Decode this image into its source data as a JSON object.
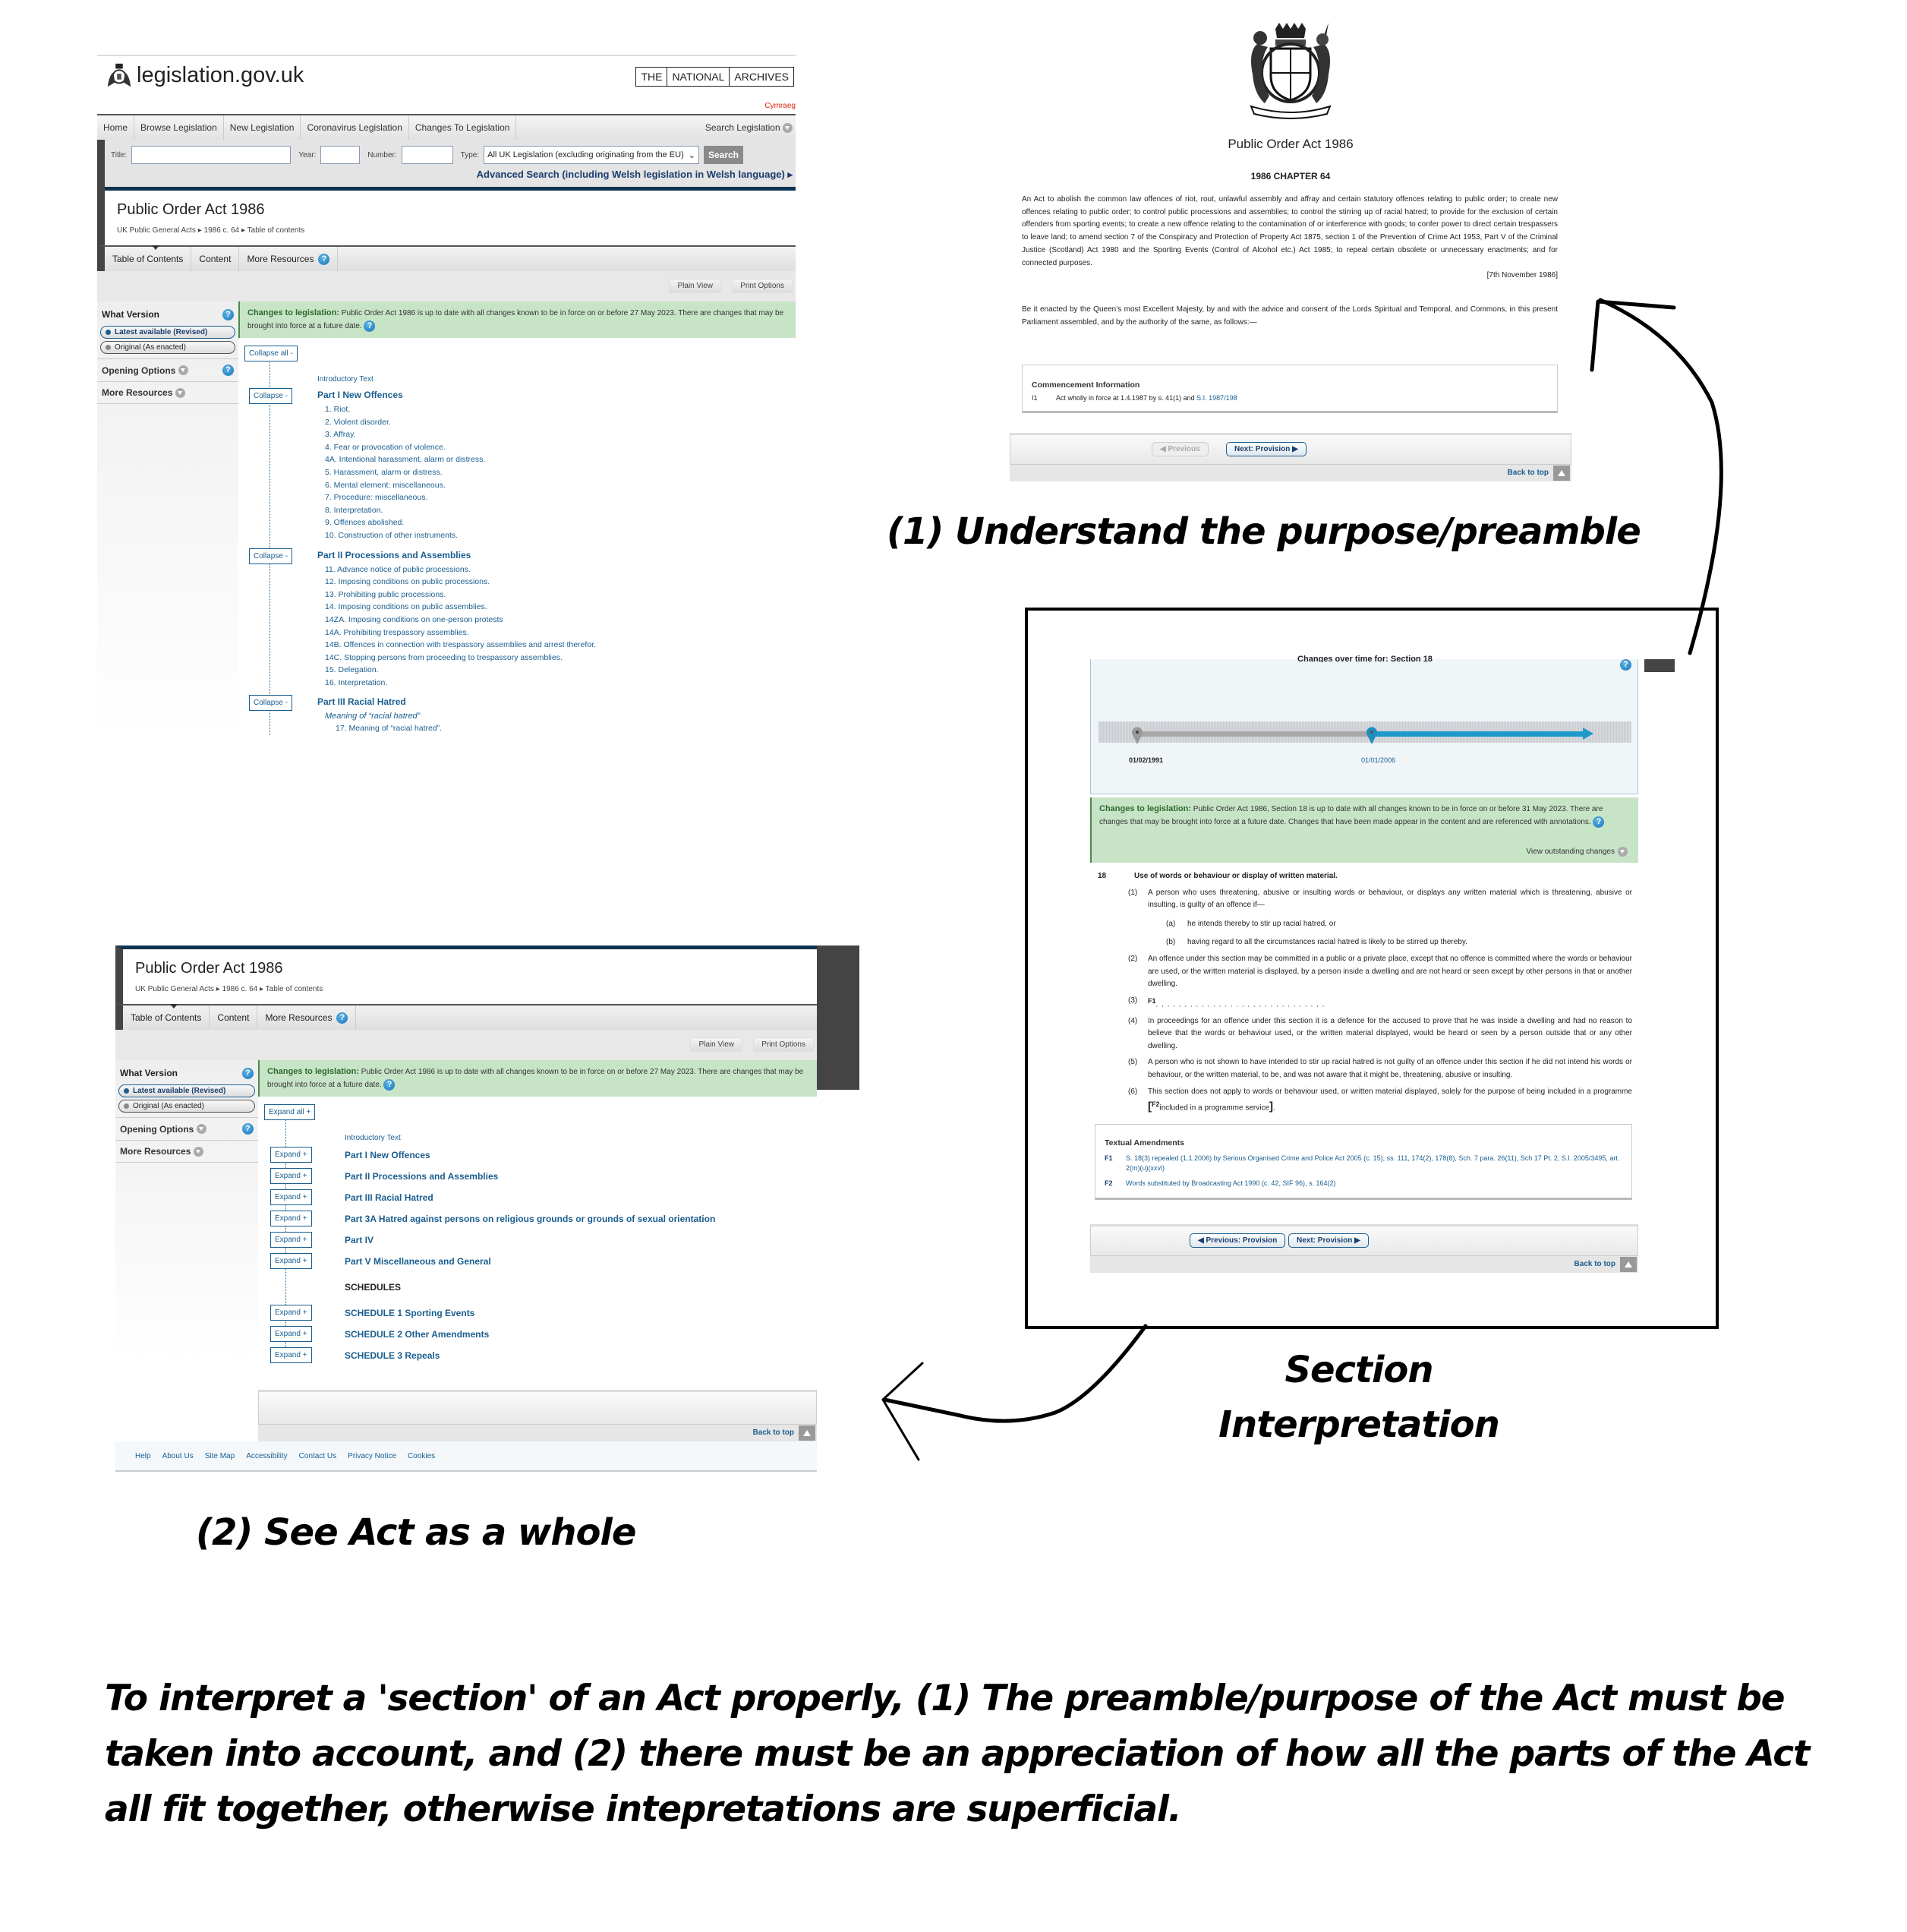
{
  "site": {
    "logo_text": "legislation.gov.uk",
    "tna": [
      "THE",
      "NATIONAL",
      "ARCHIVES"
    ],
    "cymraeg": "Cymraeg",
    "nav": [
      "Home",
      "Browse Legislation",
      "New Legislation",
      "Coronavirus Legislation",
      "Changes To Legislation"
    ],
    "search_legislation": "Search Legislation",
    "search": {
      "title_label": "Title:",
      "title_value": "",
      "year_label": "Year:",
      "year_value": "",
      "number_label": "Number:",
      "number_value": "",
      "type_label": "Type:",
      "type_value": "All UK Legislation (excluding originating from the EU)",
      "search_button": "Search",
      "advanced": "Advanced Search (including Welsh legislation in Welsh language)"
    }
  },
  "act": {
    "title": "Public Order Act 1986",
    "breadcrumb": [
      "UK Public General Acts",
      "1986 c. 64",
      "Table of contents"
    ],
    "tabs": [
      "Table of Contents",
      "Content",
      "More Resources"
    ],
    "plain_view": "Plain View",
    "print_options": "Print Options",
    "what_version": "What Version",
    "latest": "Latest available (Revised)",
    "original": "Original (As enacted)",
    "opening_options": "Opening Options",
    "more_resources": "More Resources",
    "changes_label": "Changes to legislation:",
    "changes_text": "Public Order Act 1986 is up to date with all changes known to be in force on or before 27 May 2023. There are changes that may be brought into force at a future date."
  },
  "toc_expanded": {
    "collapse_all": "Collapse all -",
    "collapse": "Collapse -",
    "introductory": "Introductory Text",
    "parts": [
      {
        "title": "Part I New Offences",
        "sections": [
          "1.  Riot.",
          "2.  Violent disorder.",
          "3.  Affray.",
          "4.  Fear or provocation of violence.",
          "4A.  Intentional harassment, alarm or distress.",
          "5.  Harassment, alarm or distress.",
          "6.  Mental element: miscellaneous.",
          "7.  Procedure: miscellaneous.",
          "8.  Interpretation.",
          "9.  Offences abolished.",
          "10.  Construction of other instruments."
        ]
      },
      {
        "title": "Part II Processions and Assemblies",
        "sections": [
          "11.  Advance notice of public processions.",
          "12.  Imposing conditions on public processions.",
          "13.  Prohibiting public processions.",
          "14.  Imposing conditions on public assemblies.",
          "14ZA. Imposing conditions on one-person protests",
          "14A.  Prohibiting trespassory assemblies.",
          "14B.  Offences in connection with trespassory assemblies and arrest therefor.",
          "14C.  Stopping persons from proceeding to trespassory assemblies.",
          "15. Delegation.",
          "16.  Interpretation."
        ]
      },
      {
        "title": "Part III Racial Hatred",
        "subheading": "Meaning of “racial hatred”",
        "sections": [
          "17.  Meaning of “racial hatred”."
        ]
      }
    ]
  },
  "preamble": {
    "title": "Public Order Act 1986",
    "chapter": "1986 CHAPTER 64",
    "long_title": "An Act to abolish the common law offences of riot, rout, unlawful assembly and affray and certain statutory offences relating to public order; to create new offences relating to public order; to control public processions and assemblies; to control the stirring up of racial hatred; to provide for the exclusion of certain offenders from sporting events; to create a new offence relating to the contamination of or interference with goods; to confer power to direct certain trespassers to leave land; to amend section 7 of the Conspiracy and Protection of Property Act 1875, section 1 of the Prevention of Crime Act 1953, Part V of the Criminal Justice (Scotland) Act 1980 and the Sporting Events (Control of Alcohol etc.) Act 1985; to repeal certain obsolete or unnecessary enactments; and for connected purposes.",
    "date": "[7th November 1986]",
    "enacting": "Be it enacted by the Queen’s most Excellent Majesty, by and with the advice and consent of the Lords Spiritual and Temporal, and Commons, in this present Parliament assembled, and by the authority of the same, as follows:—",
    "commencement_head": "Commencement Information",
    "commencement_id": "I1",
    "commencement_text": "Act wholly in force at 1.4.1987 by s. 41(1) and",
    "commencement_link": "S.I. 1987/198",
    "previous": "Previous",
    "next": "Next: Provision",
    "back_to_top": "Back to top"
  },
  "section18": {
    "timeline_title": "Changes over time for: Section 18",
    "timeline_dates": [
      "01/02/1991",
      "01/01/2006"
    ],
    "changes_label": "Changes to legislation:",
    "changes_text": "Public Order Act 1986, Section 18 is up to date with all changes known to be in force on or before 31 May 2023. There are changes that may be brought into force at a future date. Changes that have been made appear in the content and are referenced with annotations.",
    "view_outstanding": "View outstanding changes",
    "number": "18",
    "heading": "Use of words or behaviour or display of written material.",
    "subsections": [
      {
        "n": "(1)",
        "t": "A person who uses threatening, abusive or insulting words or behaviour, or displays any written material which is threatening, abusive or insulting, is guilty of an offence if—"
      },
      {
        "n": "(2)",
        "t": "An offence under this section may be committed in a public or a private place, except that no offence is committed where the words or behaviour are used, or the written material is displayed, by a person inside a dwelling and are not heard or seen except by other persons in that or another dwelling."
      },
      {
        "n": "(3)",
        "t": ". . . . . . . . . . . . . . . . . . . . . . . . . . . . . ."
      },
      {
        "n": "(4)",
        "t": "In proceedings for an offence under this section it is a defence for the accused to prove that he was inside a dwelling and had no reason to believe that the words or behaviour used, or the written material displayed, would be heard or seen by a person outside that or any other dwelling."
      },
      {
        "n": "(5)",
        "t": "A person who is not shown to have intended to stir up racial hatred is not guilty of an offence under this section if he did not intend his words or behaviour, or the written material, to be, and was not aware that it might be, threatening, abusive or insulting."
      },
      {
        "n": "(6)",
        "t": "This section does not apply to words or behaviour used, or written material displayed, solely for the purpose of being included in a programme"
      }
    ],
    "paras": [
      {
        "n": "(a)",
        "t": "he intends thereby to stir up racial hatred, or"
      },
      {
        "n": "(b)",
        "t": "having regard to all the circumstances racial hatred is likely to be stirred up thereby."
      }
    ],
    "f1_marker": "F1",
    "f2_marker": "F2",
    "f2_text": "included in a programme service",
    "amend_head": "Textual Amendments",
    "amendments": [
      {
        "id": "F1",
        "text": "S. 18(3) repealed (1.1.2006) by Serious Organised Crime and Police Act 2005 (c. 15), ss. 111, 174(2), 178(8), Sch. 7 para. 26(11), Sch 17 Pt. 2; S.I. 2005/3495, art. 2(m)(u)(xxvi)"
      },
      {
        "id": "F2",
        "text": "Words substituted by Broadcasting Act 1990 (c. 42, SIF 96), s. 164(2)"
      }
    ],
    "previous": "Previous: Provision",
    "next": "Next: Provision",
    "back_to_top": "Back to top"
  },
  "toc_collapsed": {
    "expand_all": "Expand all +",
    "expand": "Expand +",
    "introductory": "Introductory Text",
    "parts": [
      "Part I New Offences",
      "Part II Processions and Assemblies",
      "Part III Racial Hatred",
      "Part 3A Hatred against persons on religious grounds or grounds of sexual orientation",
      "Part IV",
      "Part V Miscellaneous and General"
    ],
    "schedules_head": "SCHEDULES",
    "schedules": [
      "SCHEDULE 1  Sporting Events",
      "SCHEDULE 2  Other Amendments",
      "SCHEDULE 3  Repeals"
    ],
    "back_to_top": "Back to top",
    "footer": [
      "Help",
      "About Us",
      "Site Map",
      "Accessibility",
      "Contact Us",
      "Privacy Notice",
      "Cookies"
    ]
  },
  "annotations": {
    "label1": "(1) Understand the purpose/preamble",
    "label2": "(2) See Act as a whole",
    "label3_line1": "Section",
    "label3_line2": "Interpretation",
    "caption": "To interpret a 'section' of an Act properly, (1) The preamble/purpose of the Act must be taken into account, and (2) there must be an appreciation of how all the parts of the Act all fit together, otherwise intepretations are superficial."
  }
}
